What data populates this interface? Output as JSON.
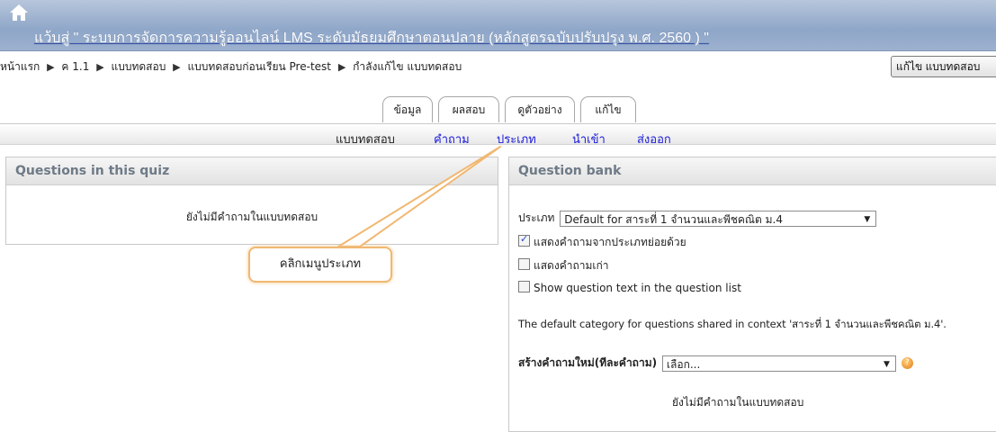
{
  "header": {
    "title": "แว้บสู่ \" ระบบการจัดการความรู้ออนไลน์ LMS ระดับมัธยมศึกษาตอนปลาย (หลักสูตรฉบับปรับปรุง พ.ศ. 2560 ) \"",
    "home_icon": "home-icon"
  },
  "breadcrumb": {
    "items": [
      "หน้าแรก",
      "ค 1.1",
      "แบบทดสอบ",
      "แบบทดสอบก่อนเรียน Pre-test",
      "กำลังแก้ไข แบบทดสอบ"
    ],
    "separator": "▶"
  },
  "edit_button": {
    "label": "แก้ไข แบบทดสอบ"
  },
  "tabs": [
    "ข้อมูล",
    "ผลสอบ",
    "ดูตัวอย่าง",
    "แก้ไข"
  ],
  "subtabs": [
    "แบบทดสอบ",
    "คำถาม",
    "ประเภท",
    "นำเข้า",
    "ส่งออก"
  ],
  "left_panel": {
    "title": "Questions in this quiz",
    "empty_text": "ยังไม่มีคำถามในแบบทดสอบ"
  },
  "right_panel": {
    "title": "Question bank",
    "category_label": "ประเภท",
    "category_value": "Default for สาระที่ 1 จำนวนและพีชคณิต ม.4",
    "checkbox_subcategories": {
      "label": "แสดงคำถามจากประเภทย่อยด้วย",
      "checked": true
    },
    "checkbox_old": {
      "label": "แสดงคำถามเก่า",
      "checked": false
    },
    "checkbox_show_text": {
      "label": "Show question text in the question list",
      "checked": false
    },
    "default_category_text": "The default category for questions shared in context 'สาระที่ 1 จำนวนและพีชคณิต ม.4'.",
    "create_label": "สร้างคำถามใหม่(ทีละคำถาม)",
    "create_select": "เลือก...",
    "empty_text": "ยังไม่มีคำถามในแบบทดสอบ"
  },
  "callout": {
    "text": "คลิกเมนูประเภท"
  },
  "colors": {
    "header_bg": "#9db1cf",
    "link_blue": "#1a1adb",
    "callout_border": "#f0b872",
    "panel_title": "#6e7a86"
  }
}
